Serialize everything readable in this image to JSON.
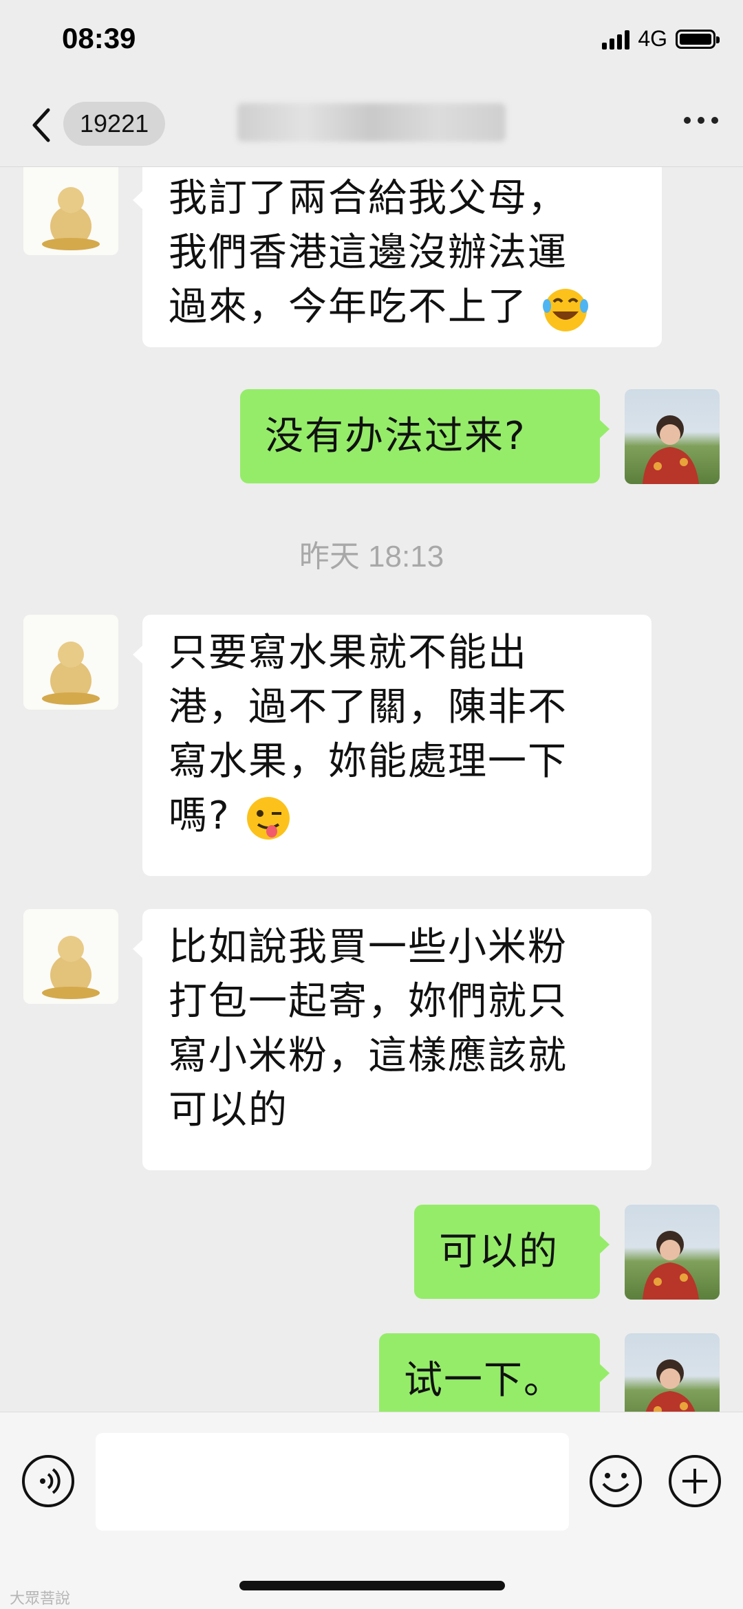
{
  "status_bar": {
    "time": "08:39",
    "network": "4G"
  },
  "nav": {
    "back_count": "19221"
  },
  "messages": [
    {
      "side": "in",
      "lines": [
        "我訂了兩合給我父母，",
        "我們香港這邊沒辦法運",
        "過來，今年吃不上了"
      ],
      "emoji": "face-laughing-tears-icon"
    },
    {
      "side": "out",
      "text": "没有办法过来?"
    },
    {
      "side": "in",
      "lines": [
        "只要寫水果就不能出",
        "港，過不了關，陳非不",
        "寫水果，妳能處理一下",
        "嗎?"
      ],
      "emoji": "winking-tongue-icon"
    },
    {
      "side": "in",
      "lines": [
        "比如說我買一些小米粉",
        "打包一起寄，妳們就只",
        "寫小米粉，這樣應該就",
        "可以的"
      ]
    },
    {
      "side": "out",
      "text": "可以的"
    },
    {
      "side": "out",
      "text": "试一下。"
    }
  ],
  "timestamp": "昨天 18:13",
  "watermark": "大眾菩說"
}
